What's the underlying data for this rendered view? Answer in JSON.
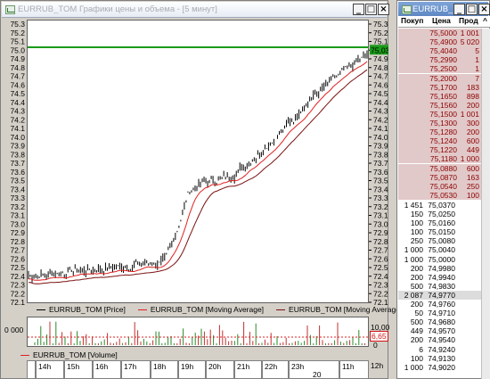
{
  "chart_window": {
    "title": "EURRUB_TOM Графики цены и объема - [5 минут]",
    "buttons": [
      "_",
      "□",
      "×"
    ],
    "price_labels": [
      "75.3",
      "75.2",
      "75.1",
      "75.0",
      "74.9",
      "74.8",
      "74.7",
      "74.6",
      "74.5",
      "74.4",
      "74.3",
      "74.2",
      "74.1",
      "74.0",
      "73.9",
      "73.8",
      "73.7",
      "73.6",
      "73.5",
      "73.4",
      "73.3",
      "73.2",
      "73.1",
      "73.0",
      "72.9",
      "72.8",
      "72.7",
      "72.6",
      "72.5",
      "72.4",
      "72.3",
      "72.2",
      "72.1"
    ],
    "current_price_badge": "75,03",
    "price_legend": [
      "EURRUB_TOM [Price]",
      "EURRUB_TOM [Moving Average]",
      "EURRUB_TOM [Moving Average]"
    ],
    "volume_labels": {
      "left_value": "0 000",
      "right_top": "10,00",
      "right_badge": "6,65",
      "right_bottom": "0"
    },
    "volume_legend": "EURRUB_TOM [Volume]",
    "time_labels": [
      "14h",
      "15h",
      "16h",
      "17h",
      "18h",
      "19h",
      "20h",
      "21h",
      "22h",
      "23h",
      "11h",
      "12h"
    ],
    "date_label": "20"
  },
  "orderbook_window": {
    "title": "EURRUB_...",
    "buttons": [
      "_",
      "□",
      "×"
    ],
    "columns": [
      "Покуп",
      "Цена",
      "Прод"
    ],
    "scroll_arrow": "^",
    "asks": [
      {
        "price": "75,5000",
        "qty": "1 001"
      },
      {
        "price": "75,4900",
        "qty": "5 020"
      },
      {
        "price": "75,4040",
        "qty": "5"
      },
      {
        "price": "75,2990",
        "qty": "1"
      },
      {
        "price": "75,2500",
        "qty": "1"
      },
      {
        "price": "75,2000",
        "qty": "7"
      },
      {
        "price": "75,1700",
        "qty": "183"
      },
      {
        "price": "75,1650",
        "qty": "898"
      },
      {
        "price": "75,1560",
        "qty": "200"
      },
      {
        "price": "75,1500",
        "qty": "1 001"
      },
      {
        "price": "75,1300",
        "qty": "300"
      },
      {
        "price": "75,1280",
        "qty": "200"
      },
      {
        "price": "75,1240",
        "qty": "600"
      },
      {
        "price": "75,1220",
        "qty": "449"
      },
      {
        "price": "75,1180",
        "qty": "1 000"
      },
      {
        "price": "75,0880",
        "qty": "600"
      },
      {
        "price": "75,0870",
        "qty": "163"
      },
      {
        "price": "75,0540",
        "qty": "250"
      },
      {
        "price": "75,0530",
        "qty": "100"
      }
    ],
    "bids": [
      {
        "qty": "1 451",
        "price": "75,0370"
      },
      {
        "qty": "150",
        "price": "75,0250"
      },
      {
        "qty": "100",
        "price": "75,0160"
      },
      {
        "qty": "100",
        "price": "75,0150"
      },
      {
        "qty": "250",
        "price": "75,0080"
      },
      {
        "qty": "1 000",
        "price": "75,0040"
      },
      {
        "qty": "1 000",
        "price": "75,0000"
      },
      {
        "qty": "200",
        "price": "74,9980"
      },
      {
        "qty": "200",
        "price": "74,9940"
      },
      {
        "qty": "500",
        "price": "74,9830"
      },
      {
        "qty": "2 087",
        "price": "74,9770"
      },
      {
        "qty": "200",
        "price": "74,9760"
      },
      {
        "qty": "50",
        "price": "74,9710"
      },
      {
        "qty": "500",
        "price": "74,9680"
      },
      {
        "qty": "449",
        "price": "74,9570"
      },
      {
        "qty": "200",
        "price": "74,9540"
      },
      {
        "qty": "6",
        "price": "74,9240"
      },
      {
        "qty": "100",
        "price": "74,9130"
      },
      {
        "qty": "1 000",
        "price": "74,9020"
      }
    ]
  },
  "colors": {
    "ask_bg": "#e2c9c9",
    "ask_text": "#8b0000",
    "bid_bg": "#ffffff",
    "bid_text": "#000000",
    "highlight_bid_bg": "#dcdcdc",
    "ma_fast": "#e02020",
    "ma_slow": "#7a1010",
    "price_line": "#1a9a1a"
  }
}
